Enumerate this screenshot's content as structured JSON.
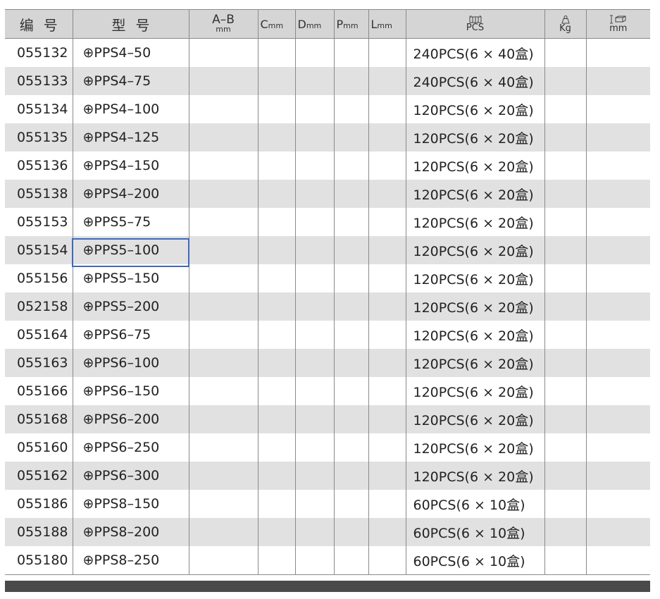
{
  "header": {
    "code": "编号",
    "model": "型号",
    "ab": "A–B",
    "ab_unit": "mm",
    "c": "C",
    "d": "D",
    "p": "P",
    "l": "L",
    "unit_mm": "mm",
    "pcs": "PCS",
    "kg": "Kg",
    "size_unit": "mm",
    "icons": {
      "pcs": "box-stack-icon",
      "kg": "weight-icon",
      "size": "carton-size-icon"
    }
  },
  "rows": [
    {
      "code": "055132",
      "model": "⊕PPS4–50",
      "pack": "240PCS(6 × 40盒)"
    },
    {
      "code": "055133",
      "model": "⊕PPS4–75",
      "pack": "240PCS(6 × 40盒)"
    },
    {
      "code": "055134",
      "model": "⊕PPS4–100",
      "pack": "120PCS(6 × 20盒)"
    },
    {
      "code": "055135",
      "model": "⊕PPS4–125",
      "pack": "120PCS(6 × 20盒)"
    },
    {
      "code": "055136",
      "model": "⊕PPS4–150",
      "pack": "120PCS(6 × 20盒)"
    },
    {
      "code": "055138",
      "model": "⊕PPS4–200",
      "pack": "120PCS(6 × 20盒)"
    },
    {
      "code": "055153",
      "model": "⊕PPS5–75",
      "pack": "120PCS(6 × 20盒)"
    },
    {
      "code": "055154",
      "model": "⊕PPS5–100",
      "pack": "120PCS(6 × 20盒)"
    },
    {
      "code": "055156",
      "model": "⊕PPS5–150",
      "pack": "120PCS(6 × 20盒)"
    },
    {
      "code": "052158",
      "model": "⊕PPS5–200",
      "pack": "120PCS(6 × 20盒)"
    },
    {
      "code": "055164",
      "model": "⊕PPS6–75",
      "pack": "120PCS(6 × 20盒)"
    },
    {
      "code": "055163",
      "model": "⊕PPS6–100",
      "pack": "120PCS(6 × 20盒)"
    },
    {
      "code": "055166",
      "model": "⊕PPS6–150",
      "pack": "120PCS(6 × 20盒)"
    },
    {
      "code": "055168",
      "model": "⊕PPS6–200",
      "pack": "120PCS(6 × 20盒)"
    },
    {
      "code": "055160",
      "model": "⊕PPS6–250",
      "pack": "120PCS(6 × 20盒)"
    },
    {
      "code": "055162",
      "model": "⊕PPS6–300",
      "pack": "120PCS(6 × 20盒)"
    },
    {
      "code": "055186",
      "model": "⊕PPS8–150",
      "pack": "60PCS(6 × 10盒)"
    },
    {
      "code": "055188",
      "model": "⊕PPS8–200",
      "pack": "60PCS(6 × 10盒)"
    },
    {
      "code": "055180",
      "model": "⊕PPS8–250",
      "pack": "60PCS(6 × 10盒)"
    }
  ],
  "colors": {
    "header_bg": "#d5d5d5",
    "stripe": "#e1e1e1",
    "selection": "#3d68c0",
    "footer_bar": "#4a4a4a"
  }
}
